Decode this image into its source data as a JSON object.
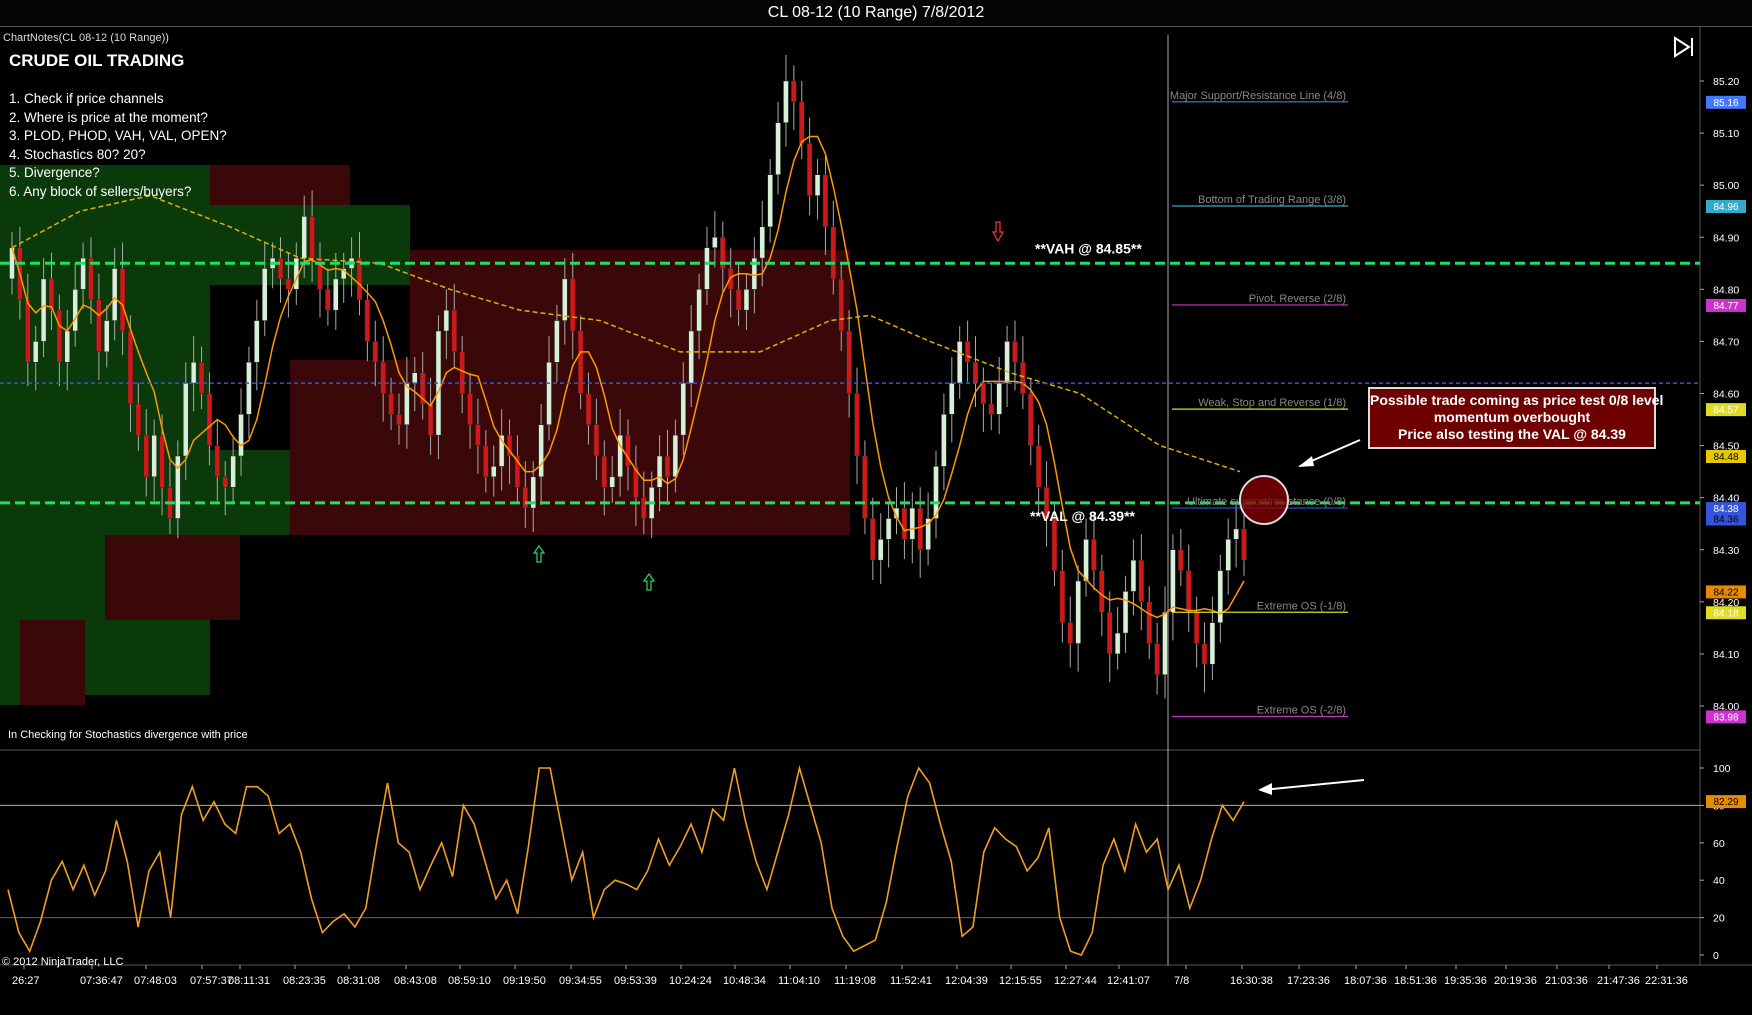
{
  "window": {
    "title": "CL 08-12 (10 Range)  7/8/2012"
  },
  "chart_notes": {
    "header": "ChartNotes(CL 08-12 (10 Range))",
    "title": "CRUDE OIL TRADING",
    "checklist": [
      "1. Check if price channels",
      "2. Where is price at the moment?",
      "3. PLOD, PHOD, VAH, VAL, OPEN?",
      "4. Stochastics 80? 20?",
      "5. Divergence?",
      "6. Any block of sellers/buyers?"
    ],
    "footer": "In  Checking for Stochastics  divergence with price"
  },
  "copyright": "© 2012 NinjaTrader, LLC",
  "icons": {
    "play_end": "play-to-end-icon",
    "up_arrow": "green-up-arrow-icon",
    "down_arrow": "red-down-arrow-icon"
  },
  "colors": {
    "background": "#000000",
    "bull": "#d8f0d8",
    "bear": "#d01818",
    "stoch": "#f0a020",
    "ma": "#ff9900",
    "vah_val": "#22dd66",
    "pivot": "#cc33cc",
    "blue_line": "#3355dd",
    "dashed_ma": "#e0b000"
  },
  "annotations": {
    "vah": "**VAH @ 84.85**",
    "val": "**VAL @ 84.39**",
    "trade_box": [
      "Possible trade coming as price test 0/8 level",
      "momentum overbought",
      "Price also testing the VAL @ 84.39"
    ]
  },
  "chart_data": [
    {
      "type": "candlestick",
      "title": "CL 08-12 (10 Range)  7/8/2012",
      "ylim": [
        83.93,
        85.26
      ],
      "y_ticks": [
        "85.20",
        "85.10",
        "85.00",
        "84.90",
        "84.80",
        "84.70",
        "84.60",
        "84.50",
        "84.40",
        "84.30",
        "84.20",
        "84.10",
        "84.00"
      ],
      "x_tick_labels": [
        "26:27",
        "07:36:47",
        "07:48:03",
        "07:57:37",
        "08:11:31",
        "08:23:35",
        "08:31:08",
        "08:43:08",
        "08:59:10",
        "09:19:50",
        "09:34:55",
        "09:53:39",
        "10:24:24",
        "10:48:34",
        "11:04:10",
        "11:19:08",
        "11:52:41",
        "12:04:39",
        "12:15:55",
        "12:27:44",
        "12:41:07",
        "7/8",
        "16:30:38",
        "17:23:36",
        "18:07:36",
        "18:51:36",
        "19:35:36",
        "20:19:36",
        "21:03:36",
        "21:47:36",
        "22:31:36"
      ],
      "closes": [
        84.88,
        84.78,
        84.66,
        84.7,
        84.82,
        84.76,
        84.66,
        84.72,
        84.8,
        84.86,
        84.78,
        84.68,
        84.74,
        84.84,
        84.72,
        84.58,
        84.52,
        84.44,
        84.52,
        84.42,
        84.36,
        84.48,
        84.62,
        84.66,
        84.6,
        84.5,
        84.44,
        84.42,
        84.48,
        84.56,
        84.66,
        84.74,
        84.84,
        84.86,
        84.82,
        84.8,
        84.86,
        84.94,
        84.86,
        84.8,
        84.76,
        84.82,
        84.84,
        84.86,
        84.78,
        84.7,
        84.66,
        84.6,
        84.56,
        84.54,
        84.62,
        84.64,
        84.58,
        84.52,
        84.72,
        84.76,
        84.68,
        84.6,
        84.54,
        84.5,
        84.44,
        84.46,
        84.52,
        84.48,
        84.42,
        84.38,
        84.44,
        84.54,
        84.66,
        84.74,
        84.82,
        84.72,
        84.6,
        84.54,
        84.48,
        84.42,
        84.44,
        84.52,
        84.46,
        84.4,
        84.36,
        84.42,
        84.48,
        84.44,
        84.52,
        84.62,
        84.72,
        84.8,
        84.88,
        84.9,
        84.84,
        84.8,
        84.76,
        84.8,
        84.86,
        84.92,
        85.02,
        85.12,
        85.2,
        85.16,
        85.08,
        84.98,
        85.02,
        84.92,
        84.82,
        84.72,
        84.6,
        84.48,
        84.36,
        84.28,
        84.32,
        84.36,
        84.38,
        84.32,
        84.38,
        84.3,
        84.36,
        84.46,
        84.56,
        84.62,
        84.7,
        84.66,
        84.62,
        84.58,
        84.56,
        84.62,
        84.7,
        84.66,
        84.6,
        84.5,
        84.42,
        84.36,
        84.26,
        84.16,
        84.12,
        84.24,
        84.32,
        84.26,
        84.18,
        84.1,
        84.14,
        84.22,
        84.28,
        84.2,
        84.12,
        84.06,
        84.18,
        84.3,
        84.26,
        84.18,
        84.12,
        84.08,
        84.16,
        84.26,
        84.32,
        84.34,
        84.28
      ]
    },
    {
      "type": "line",
      "name": "Stochastics",
      "ylim": [
        -5,
        110
      ],
      "y_ticks": [
        "100",
        "80",
        "60",
        "40",
        "20",
        "0"
      ],
      "current_value": "82.29",
      "reference_lines": [
        80,
        20
      ],
      "values": [
        35,
        12,
        2,
        18,
        40,
        50,
        35,
        48,
        32,
        45,
        72,
        50,
        15,
        45,
        55,
        20,
        75,
        90,
        72,
        82,
        70,
        65,
        90,
        90,
        85,
        65,
        70,
        55,
        30,
        12,
        18,
        22,
        15,
        25,
        60,
        92,
        60,
        55,
        35,
        48,
        60,
        42,
        80,
        70,
        50,
        30,
        40,
        22,
        58,
        100,
        100,
        70,
        40,
        55,
        20,
        35,
        40,
        38,
        35,
        45,
        62,
        48,
        58,
        70,
        55,
        78,
        72,
        100,
        72,
        50,
        35,
        55,
        75,
        100,
        80,
        60,
        25,
        10,
        2,
        5,
        8,
        28,
        58,
        85,
        100,
        92,
        70,
        50,
        10,
        15,
        55,
        68,
        62,
        58,
        45,
        52,
        68,
        20,
        2,
        0,
        12,
        48,
        62,
        45,
        70,
        55,
        62,
        35,
        48,
        25,
        40,
        62,
        80,
        72,
        82
      ]
    }
  ],
  "price_labels": {
    "levels": [
      {
        "text": "Major Support/Resistance Line (4/8)",
        "value": 85.16,
        "tag": "85.16"
      },
      {
        "text": "Bottom of Trading Range (3/8)",
        "value": 84.96,
        "tag": "84.96"
      },
      {
        "text": "Pivot, Reverse (2/8)",
        "value": 84.77,
        "tag": "84.77"
      },
      {
        "text": "Weak, Stop and Reverse (1/8)",
        "value": 84.57,
        "tag": "84.57"
      },
      {
        "text": "Ultimate support/resistance (0/8)",
        "value": 84.38,
        "tag": "84.38"
      },
      {
        "text": "Extreme OS (-1/8)",
        "value": 84.18,
        "tag": "84.18"
      },
      {
        "text": "Extreme OS (-2/8)",
        "value": 83.98,
        "tag": "83.98"
      }
    ],
    "extra_tags": [
      {
        "tag": "84.48",
        "value": 84.48
      },
      {
        "tag": "84.36",
        "value": 84.36
      },
      {
        "tag": "84.22",
        "value": 84.22
      }
    ]
  }
}
